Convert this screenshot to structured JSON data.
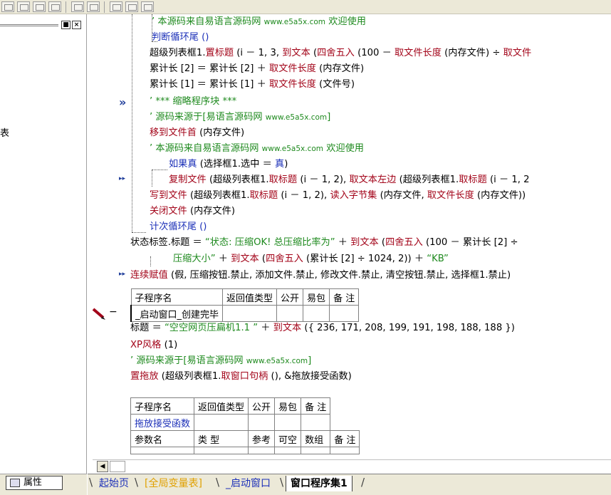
{
  "left_panel": {
    "fragment": "表",
    "controls": [
      "■",
      "×"
    ],
    "properties_tab": "属性"
  },
  "gutter": {
    "marker_double": "»",
    "marker_arrow1": "▸▸",
    "marker_arrow2": "▸▸",
    "minus": "−"
  },
  "code": {
    "lines": [
      {
        "parts": [
          {
            "t": "’ 本源码来自易语言源码网 ",
            "c": "g"
          },
          {
            "t": "www.e5a5x.com",
            "c": "g sm"
          },
          {
            "t": "  欢迎使用",
            "c": "g"
          }
        ]
      },
      {
        "parts": [
          {
            "t": "判断循环尾 ()",
            "c": "b"
          }
        ]
      },
      {
        "parts": [
          {
            "t": "超级列表框1.",
            "c": "k"
          },
          {
            "t": "置标题",
            "c": "r"
          },
          {
            "t": " (i － 1, 3, ",
            "c": "k"
          },
          {
            "t": "到文本",
            "c": "r"
          },
          {
            "t": " (",
            "c": "k"
          },
          {
            "t": "四舍五入",
            "c": "r"
          },
          {
            "t": " (100 － ",
            "c": "k"
          },
          {
            "t": "取文件长度",
            "c": "r"
          },
          {
            "t": " (内存文件) ÷ ",
            "c": "k"
          },
          {
            "t": "取文件",
            "c": "r"
          }
        ]
      },
      {
        "parts": [
          {
            "t": "累计长 [2] ＝ 累计长 [2] ＋ ",
            "c": "k"
          },
          {
            "t": "取文件长度",
            "c": "r"
          },
          {
            "t": " (内存文件)",
            "c": "k"
          }
        ]
      },
      {
        "parts": [
          {
            "t": "累计长 [1] ＝ 累计长 [1] ＋ ",
            "c": "k"
          },
          {
            "t": "取文件长度",
            "c": "r"
          },
          {
            "t": " (文件号)",
            "c": "k"
          }
        ]
      },
      {
        "parts": [
          {
            "t": "’ *** 缩略程序块 ***",
            "c": "g"
          }
        ]
      },
      {
        "parts": [
          {
            "t": "’ 源码来源于[易语言源码网 ",
            "c": "g"
          },
          {
            "t": "www.e5a5x.com",
            "c": "g sm"
          },
          {
            "t": "]",
            "c": "g"
          }
        ]
      },
      {
        "parts": [
          {
            "t": "移到文件首",
            "c": "r"
          },
          {
            "t": " (内存文件)",
            "c": "k"
          }
        ]
      },
      {
        "parts": [
          {
            "t": "’ 本源码来自易语言源码网 ",
            "c": "g"
          },
          {
            "t": "www.e5a5x.com",
            "c": "g sm"
          },
          {
            "t": "  欢迎使用",
            "c": "g"
          }
        ]
      },
      {
        "parts": [
          {
            "t": "如果真",
            "c": "b"
          },
          {
            "t": " (选择框1.选中 ＝ ",
            "c": "k"
          },
          {
            "t": "真",
            "c": "b"
          },
          {
            "t": ")",
            "c": "k"
          }
        ]
      },
      {
        "parts": [
          {
            "t": "复制文件",
            "c": "r"
          },
          {
            "t": " (超级列表框1.",
            "c": "k"
          },
          {
            "t": "取标题",
            "c": "r"
          },
          {
            "t": " (i － 1, 2), ",
            "c": "k"
          },
          {
            "t": "取文本左边",
            "c": "r"
          },
          {
            "t": " (超级列表框1.",
            "c": "k"
          },
          {
            "t": "取标题",
            "c": "r"
          },
          {
            "t": " (i － 1, 2",
            "c": "k"
          }
        ]
      },
      {
        "parts": [
          {
            "t": "写到文件",
            "c": "r"
          },
          {
            "t": " (超级列表框1.",
            "c": "k"
          },
          {
            "t": "取标题",
            "c": "r"
          },
          {
            "t": " (i － 1, 2), ",
            "c": "k"
          },
          {
            "t": "读入字节集",
            "c": "r"
          },
          {
            "t": " (内存文件, ",
            "c": "k"
          },
          {
            "t": "取文件长度",
            "c": "r"
          },
          {
            "t": " (内存文件))",
            "c": "k"
          }
        ]
      },
      {
        "parts": [
          {
            "t": "关闭文件",
            "c": "r"
          },
          {
            "t": " (内存文件)",
            "c": "k"
          }
        ]
      },
      {
        "parts": [
          {
            "t": "计次循环尾 ()",
            "c": "b"
          }
        ]
      },
      {
        "parts": [
          {
            "t": "状态标签.标题 ＝ ",
            "c": "k"
          },
          {
            "t": "“状态: 压缩OK! 总压缩比率为”",
            "c": "g"
          },
          {
            "t": " ＋ ",
            "c": "k"
          },
          {
            "t": "到文本",
            "c": "r"
          },
          {
            "t": " (",
            "c": "k"
          },
          {
            "t": "四舍五入",
            "c": "r"
          },
          {
            "t": " (100 － 累计长 [2] ÷",
            "c": "k"
          }
        ]
      },
      {
        "parts": [
          {
            "t": "压缩大小”",
            "c": "g"
          },
          {
            "t": " ＋ ",
            "c": "k"
          },
          {
            "t": "到文本",
            "c": "r"
          },
          {
            "t": " (",
            "c": "k"
          },
          {
            "t": "四舍五入",
            "c": "r"
          },
          {
            "t": " (累计长 [2] ÷ 1024, 2)) ＋ ",
            "c": "k"
          },
          {
            "t": "“KB”",
            "c": "g"
          }
        ]
      },
      {
        "parts": [
          {
            "t": "连续赋值",
            "c": "r"
          },
          {
            "t": " (假, 压缩按钮.禁止, 添加文件.禁止, 修改文件.禁止, 清空按钮.禁止, 选择框1.禁止)",
            "c": "k"
          }
        ]
      }
    ],
    "lines_after": [
      {
        "parts": [
          {
            "t": "标题 ＝ ",
            "c": "k"
          },
          {
            "t": "“空空网页压扁机1.1     ”",
            "c": "g"
          },
          {
            "t": " ＋ ",
            "c": "k"
          },
          {
            "t": "到文本",
            "c": "r"
          },
          {
            "t": " ({ 236, 171, 208, 199, 191, 198, 188, 188 })",
            "c": "k"
          }
        ]
      },
      {
        "parts": [
          {
            "t": "XP风格",
            "c": "r"
          },
          {
            "t": " (1)",
            "c": "k"
          }
        ]
      },
      {
        "parts": [
          {
            "t": "’ 源码来源于[易语言源码网 ",
            "c": "g"
          },
          {
            "t": "www.e5a5x.com",
            "c": "g sm"
          },
          {
            "t": "]",
            "c": "g"
          }
        ]
      },
      {
        "parts": [
          {
            "t": "置拖放",
            "c": "r"
          },
          {
            "t": " (超级列表框1.",
            "c": "k"
          },
          {
            "t": "取窗口句柄",
            "c": "r"
          },
          {
            "t": " (), &拖放接受函数)",
            "c": "k"
          }
        ]
      }
    ]
  },
  "table1": {
    "headers": [
      "子程序名",
      "返回值类型",
      "公开",
      "易包",
      "备 注"
    ],
    "row": [
      "_启动窗口_创建完毕",
      "",
      "",
      "",
      ""
    ]
  },
  "table2": {
    "headers": [
      "子程序名",
      "返回值类型",
      "公开",
      "易包",
      "备 注"
    ],
    "row": [
      "拖放接受函数",
      "",
      "",
      "",
      ""
    ],
    "param_headers": [
      "参数名",
      "类 型",
      "参考",
      "可空",
      "数组",
      "备 注"
    ]
  },
  "tabs": [
    "起始页",
    "[全局变量表]",
    "_启动窗口",
    "窗口程序集1"
  ]
}
